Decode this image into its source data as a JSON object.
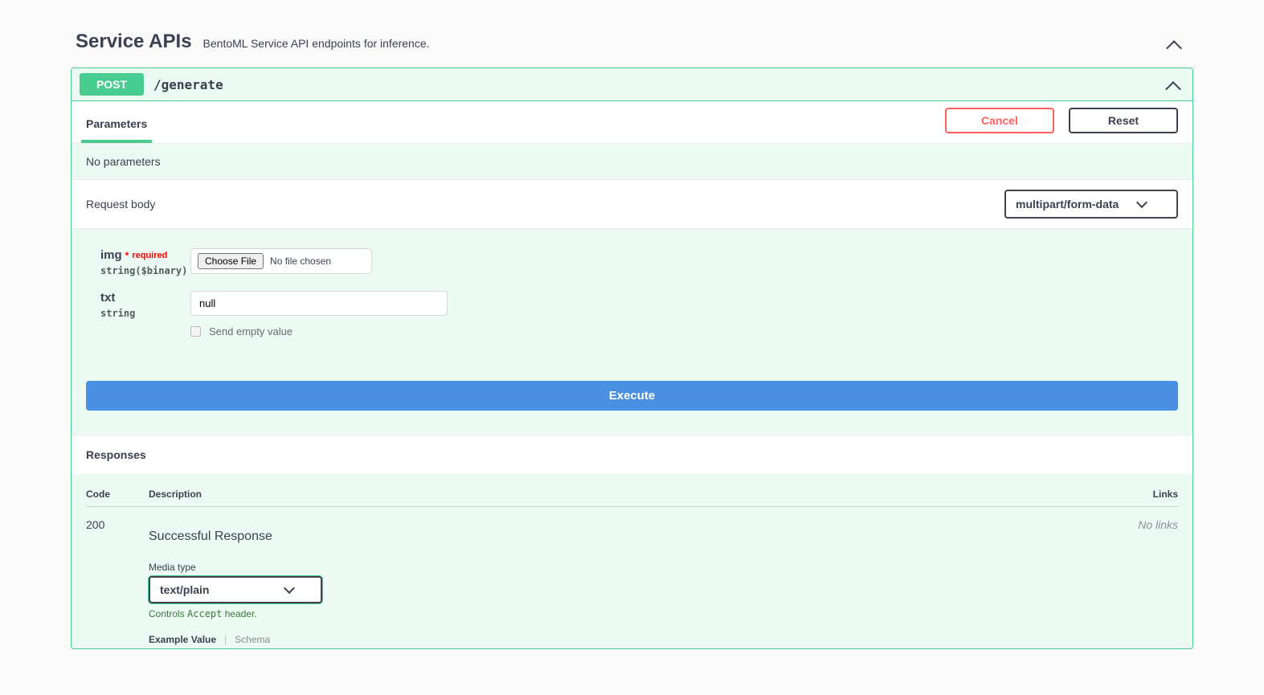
{
  "section": {
    "title": "Service APIs",
    "subtitle": "BentoML Service API endpoints for inference."
  },
  "op": {
    "method": "POST",
    "path": "/generate"
  },
  "tabs": {
    "parameters": "Parameters",
    "cancel": "Cancel",
    "reset": "Reset"
  },
  "no_params": "No parameters",
  "request_body": {
    "label": "Request body",
    "content_type": "multipart/form-data"
  },
  "params": {
    "img": {
      "name": "img",
      "required_label": "required",
      "type": "string($binary)",
      "choose_file": "Choose File",
      "no_file": "No file chosen"
    },
    "txt": {
      "name": "txt",
      "type": "string",
      "value": "null",
      "send_empty": "Send empty value"
    }
  },
  "execute": "Execute",
  "responses": {
    "header": "Responses",
    "cols": {
      "code": "Code",
      "desc": "Description",
      "links": "Links"
    },
    "row": {
      "code": "200",
      "desc": "Successful Response",
      "links": "No links",
      "media_type_label": "Media type",
      "media_type": "text/plain",
      "accept_note_pre": "Controls ",
      "accept_code": "Accept",
      "accept_note_post": " header.",
      "example_value": "Example Value",
      "schema": "Schema"
    }
  }
}
